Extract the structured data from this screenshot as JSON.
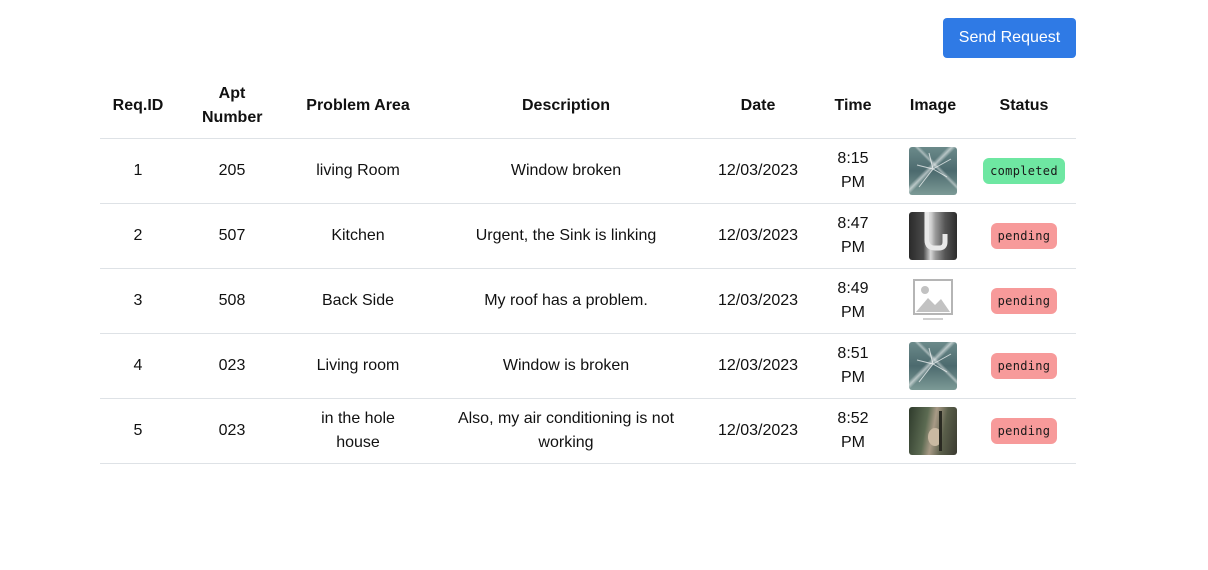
{
  "toolbar": {
    "send_request_label": "Send Request"
  },
  "table": {
    "headers": {
      "req_id": "Req.ID",
      "apt_number": "Apt Number",
      "problem_area": "Problem Area",
      "description": "Description",
      "date": "Date",
      "time": "Time",
      "image": "Image",
      "status": "Status"
    },
    "rows": [
      {
        "req_id": "1",
        "apt_number": "205",
        "problem_area": "living Room",
        "description": "Window broken",
        "date": "12/03/2023",
        "time": "8:15 PM",
        "image": "broken-window-photo",
        "status": "completed"
      },
      {
        "req_id": "2",
        "apt_number": "507",
        "problem_area": "Kitchen",
        "description": "Urgent, the Sink is linking",
        "date": "12/03/2023",
        "time": "8:47 PM",
        "image": "sink-pipe-photo",
        "status": "pending"
      },
      {
        "req_id": "3",
        "apt_number": "508",
        "problem_area": "Back Side",
        "description": "My roof has a problem.",
        "date": "12/03/2023",
        "time": "8:49 PM",
        "image": "image-placeholder-icon",
        "status": "pending"
      },
      {
        "req_id": "4",
        "apt_number": "023",
        "problem_area": "Living room",
        "description": "Window is broken",
        "date": "12/03/2023",
        "time": "8:51 PM",
        "image": "broken-window-photo",
        "status": "pending"
      },
      {
        "req_id": "5",
        "apt_number": "023",
        "problem_area": "in the hole house",
        "description": "Also, my air conditioning is not working",
        "date": "12/03/2023",
        "time": "8:52 PM",
        "image": "air-conditioner-photo",
        "status": "pending"
      }
    ]
  },
  "colors": {
    "primary": "#2f7ae5",
    "completed": "#6ee7a2",
    "pending": "#f79a9a"
  }
}
